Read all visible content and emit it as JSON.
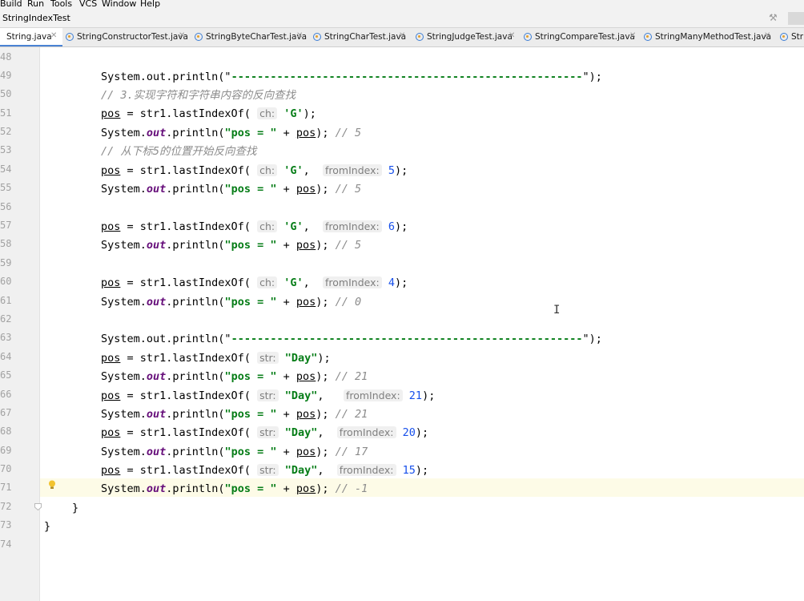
{
  "menu": [
    "Build",
    "Run",
    "Tools",
    "VCS",
    "Window",
    "Help"
  ],
  "breadcrumb": "StringIndexTest",
  "tabs": [
    {
      "label": "String.java",
      "active": true
    },
    {
      "label": "StringConstructorTest.java",
      "active": false
    },
    {
      "label": "StringByteCharTest.java",
      "active": false
    },
    {
      "label": "StringCharTest.java",
      "active": false
    },
    {
      "label": "StringJudgeTest.java",
      "active": false
    },
    {
      "label": "StringCompareTest.java",
      "active": false
    },
    {
      "label": "StringManyMethodTest.java",
      "active": false
    },
    {
      "label": "Stri",
      "active": false
    }
  ],
  "line_numbers": [
    "48",
    "49",
    "50",
    "51",
    "52",
    "53",
    "54",
    "55",
    "56",
    "57",
    "58",
    "59",
    "60",
    "61",
    "62",
    "63",
    "64",
    "65",
    "66",
    "67",
    "68",
    "69",
    "70",
    "71",
    "72",
    "73",
    "74"
  ],
  "code": {
    "separator_call": "System.out.println(\"",
    "separator": "------------------------------------------------------",
    "close_paren": "\");",
    "comment_reverse": "// 3.实现字符和字符串内容的反向查找",
    "comment_from5": "// 从下标5的位置开始反向查找",
    "pos": "pos",
    "eq_call": " = str1.lastIndexOf( ",
    "hint_ch": "ch:",
    "hint_str": "str:",
    "hint_from": "fromIndex:",
    "char_g": "'G'",
    "str_day": "\"Day\"",
    "comma": ",  ",
    "end_call": ");",
    "print_pre": "System.",
    "out": "out",
    "print_mid": ".println(",
    "print_str": "\"pos = \"",
    "print_plus": " + ",
    "print_end": "); ",
    "n5": "5",
    "n6": "6",
    "n4": "4",
    "n21": "21",
    "n20": "20",
    "n15": "15",
    "c5": "// 5",
    "c0": "// 0",
    "c21": "// 21",
    "c17": "// 17",
    "cm1": "// -1",
    "brace": "}"
  }
}
